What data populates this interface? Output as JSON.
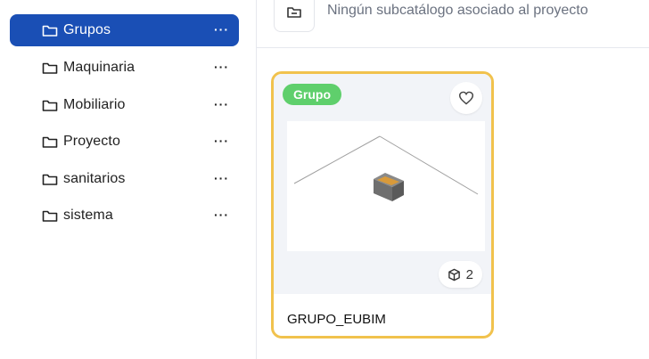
{
  "sidebar": {
    "items": [
      {
        "label": "Grupos",
        "more": "···",
        "active": true
      },
      {
        "label": "Maquinaria",
        "more": "···"
      },
      {
        "label": "Mobiliario",
        "more": "···"
      },
      {
        "label": "Proyecto",
        "more": "···"
      },
      {
        "label": "sanitarios",
        "more": "···"
      },
      {
        "label": "sistema",
        "more": "···"
      }
    ]
  },
  "main": {
    "empty_message": "Ningún subcatálogo asociado al proyecto",
    "card": {
      "badge": "Grupo",
      "count": "2",
      "title": "GRUPO_EUBIM"
    }
  },
  "colors": {
    "accent": "#1a4fb5",
    "badge": "#5fcf6c",
    "card_border": "#f1c24d"
  },
  "icons": [
    "folder-icon",
    "more-dots-icon",
    "subcatalog-icon",
    "heart-icon",
    "cube-icon"
  ]
}
